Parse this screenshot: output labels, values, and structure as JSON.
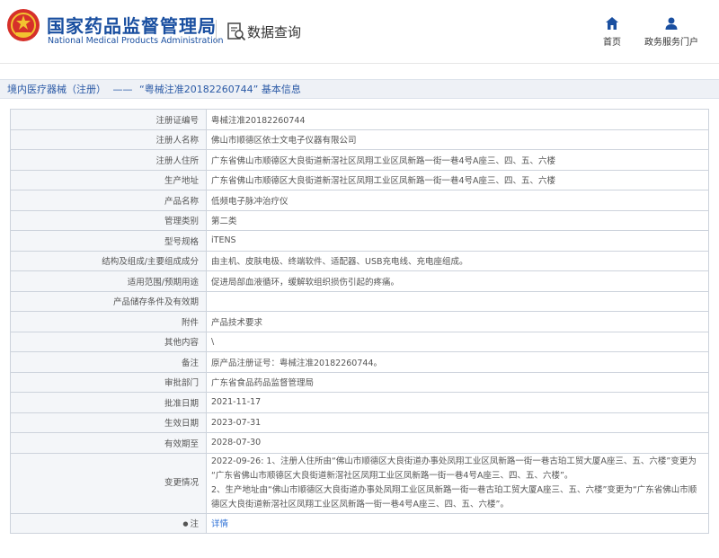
{
  "header": {
    "brand_cn": "国家药品监督管理局",
    "brand_en": "National Medical Products Administration",
    "query_title": "数据查询",
    "nav": [
      {
        "label": "首页",
        "icon": "home-icon"
      },
      {
        "label": "政务服务门户",
        "icon": "user-icon"
      }
    ]
  },
  "breadcrumb": {
    "section": "境内医疗器械（注册）",
    "separator": "——",
    "current": "“粤械注准20182260744” 基本信息"
  },
  "colors": {
    "brand": "#1a4fa0",
    "link": "#2b6fd6",
    "label_bg": "#f4f6f9",
    "border": "#cdd3dc"
  },
  "rows": [
    {
      "label": "注册证编号",
      "value": "粤械注准20182260744"
    },
    {
      "label": "注册人名称",
      "value": "佛山市顺德区依士文电子仪器有限公司"
    },
    {
      "label": "注册人住所",
      "value": "广东省佛山市顺德区大良街道新滘社区凤翔工业区凤新路一街一巷4号A座三、四、五、六楼"
    },
    {
      "label": "生产地址",
      "value": "广东省佛山市顺德区大良街道新滘社区凤翔工业区凤新路一街一巷4号A座三、四、五、六楼"
    },
    {
      "label": "产品名称",
      "value": "低频电子脉冲治疗仪"
    },
    {
      "label": "管理类别",
      "value": "第二类"
    },
    {
      "label": "型号规格",
      "value": "iTENS"
    },
    {
      "label": "结构及组成/主要组成成分",
      "value": "由主机、皮肤电极、终端软件、适配器、USB充电线、充电座组成。"
    },
    {
      "label": "适用范围/预期用途",
      "value": "促进局部血液循环，缓解软组织损伤引起的疼痛。"
    },
    {
      "label": "产品储存条件及有效期",
      "value": ""
    },
    {
      "label": "附件",
      "value": "产品技术要求"
    },
    {
      "label": "其他内容",
      "value": "\\"
    },
    {
      "label": "备注",
      "value": "原产品注册证号：粤械注准20182260744。"
    },
    {
      "label": "审批部门",
      "value": "广东省食品药品监督管理局"
    },
    {
      "label": "批准日期",
      "value": "2021-11-17"
    },
    {
      "label": "生效日期",
      "value": "2023-07-31"
    },
    {
      "label": "有效期至",
      "value": "2028-07-30"
    }
  ],
  "change": {
    "label": "变更情况",
    "lines": [
      "2022-09-26: 1、注册人住所由“佛山市顺德区大良街道办事处凤翔工业区凤新路一街一巷古珀工贸大厦A座三、五、六楼”变更为",
      "“广东省佛山市顺德区大良街道新滘社区凤翔工业区凤新路一街一巷4号A座三、四、五、六楼”。",
      "2、生产地址由“佛山市顺德区大良街道办事处凤翔工业区凤新路一街一巷古珀工贸大厦A座三、五、六楼”变更为“广东省佛山市顺",
      "德区大良街道新滘社区凤翔工业区凤新路一街一巷4号A座三、四、五、六楼”。"
    ]
  },
  "note": {
    "label": "注",
    "link": "详情"
  }
}
